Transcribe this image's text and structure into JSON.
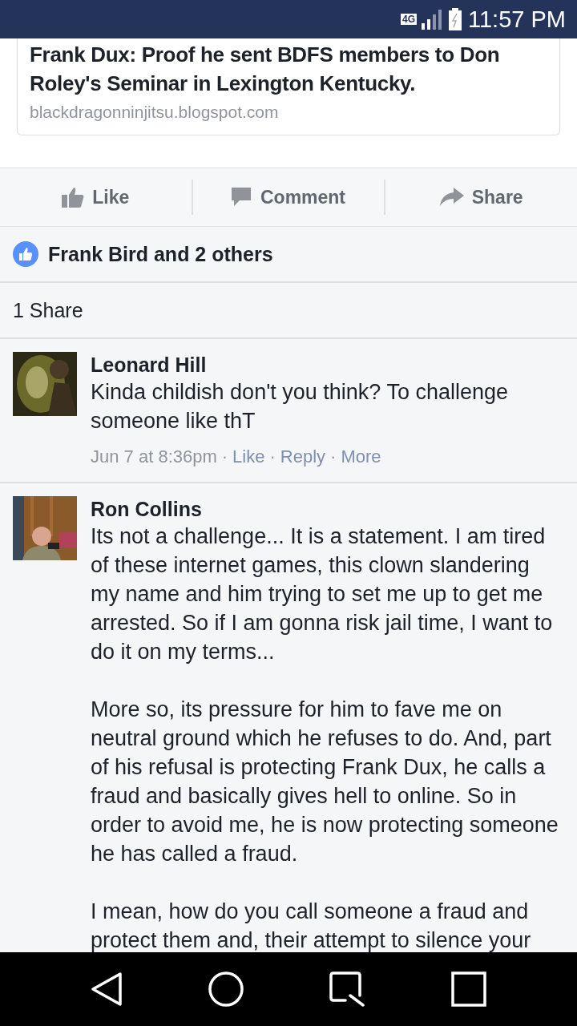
{
  "status_bar": {
    "network": "4G",
    "time": "11:57 PM"
  },
  "link_card": {
    "title": "Frank Dux: Proof he sent BDFS members to Don Roley's Seminar in Lexington Kentucky.",
    "domain": "blackdragonninjitsu.blogspot.com"
  },
  "actions": [
    {
      "kind": "like",
      "label": "Like"
    },
    {
      "kind": "comment",
      "label": "Comment"
    },
    {
      "kind": "share",
      "label": "Share"
    }
  ],
  "likes": "Frank Bird and 2 others",
  "shares": "1 Share",
  "comments": [
    {
      "author": "Leonard Hill",
      "paragraphs": [
        "Kinda childish don't you think? To challenge someone like thT"
      ],
      "meta": {
        "time": "Jun 7 at 8:36pm",
        "separator": "·",
        "actions": [
          "Like",
          "Reply",
          "More"
        ]
      },
      "avatar": {
        "kind": "picture"
      }
    },
    {
      "author": "Ron Collins",
      "paragraphs": [
        "Its not a challenge... It is a statement. I am tired of these internet games, this clown slandering my name and him trying to set me up to get me arrested. So if I am gonna risk jail time, I want to do it on my terms...",
        "More so, its pressure for him to fave me on neutral ground which he refuses to do. And, part of his refusal is protecting Frank Dux, he calls a fraud and basically gives hell to online. So in order to avoid me, he is now protecting someone he has called a fraud.",
        "I mean, how do you call someone a fraud and protect them and, their attempt to silence your"
      ],
      "avatar": {
        "kind": "picture"
      }
    }
  ]
}
